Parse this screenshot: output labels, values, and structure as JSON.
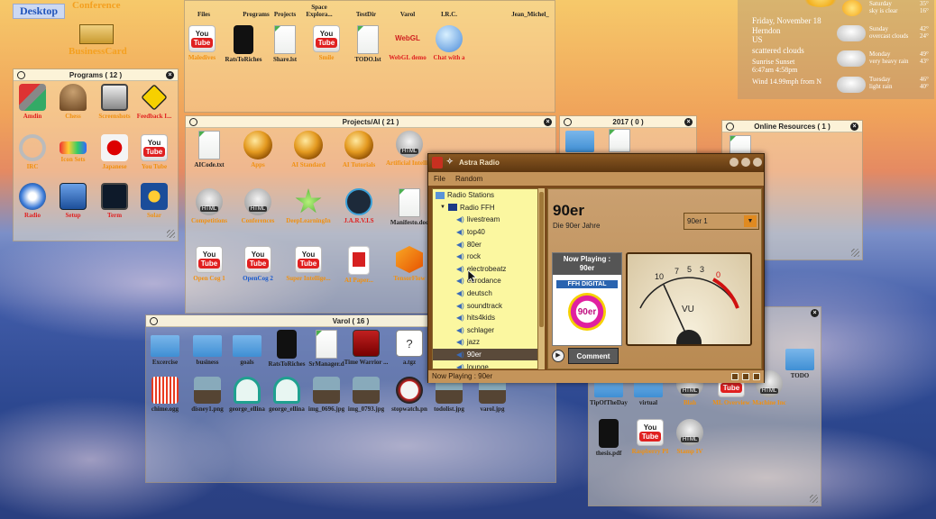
{
  "desktop": {
    "label": "Desktop",
    "conference": "Conference",
    "businesscard": "BusinessCard"
  },
  "top_icons": [
    {
      "label": "Files",
      "icon": "files-icon"
    },
    {
      "label": "Programs",
      "icon": "programs-icon"
    },
    {
      "label": "Projects",
      "icon": "projects-icon"
    },
    {
      "label": "Space Explora...",
      "icon": "space-icon"
    },
    {
      "label": "TestDir",
      "icon": "testdir-icon"
    },
    {
      "label": "Varol",
      "icon": "varol-icon"
    },
    {
      "label": "I.R.C.",
      "icon": "irc-icon"
    },
    {
      "label": "Jean_Michel_",
      "icon": "jean-michel-icon"
    }
  ],
  "top_row2": [
    {
      "label": "Maledives",
      "color": "org",
      "icon": "youtube-icon"
    },
    {
      "label": "RatsToRiches",
      "color": "blk",
      "icon": "book-icon"
    },
    {
      "label": "Share.lst",
      "color": "blk",
      "icon": "document-icon"
    },
    {
      "label": "Smile",
      "color": "org",
      "icon": "youtube-icon"
    },
    {
      "label": "TODO.lst",
      "color": "blk",
      "icon": "document-icon"
    },
    {
      "label": "WebGL demo",
      "color": "red",
      "icon": "webgl-icon"
    },
    {
      "label": "Chat with a",
      "color": "red",
      "icon": "chat-icon"
    }
  ],
  "programs": {
    "title": "Programs ( 12 )",
    "items": [
      {
        "label": "Amdin",
        "color": "red",
        "icon": "admin-tools-icon"
      },
      {
        "label": "Chess",
        "color": "org",
        "icon": "chess-icon"
      },
      {
        "label": "Screenshots",
        "color": "org",
        "icon": "camera-icon"
      },
      {
        "label": "Feedback I...",
        "color": "red",
        "icon": "feedback-icon"
      },
      {
        "label": "IRC",
        "color": "org",
        "icon": "irc-chain-icon"
      },
      {
        "label": "Icon Sets",
        "color": "org",
        "icon": "icon-sets-icon"
      },
      {
        "label": "Japanese",
        "color": "org",
        "icon": "japan-flag-icon"
      },
      {
        "label": "You Tube",
        "color": "org",
        "icon": "youtube-icon"
      },
      {
        "label": "Radio",
        "color": "red",
        "icon": "radio-icon"
      },
      {
        "label": "Setup",
        "color": "red",
        "icon": "setup-icon"
      },
      {
        "label": "Term",
        "color": "red",
        "icon": "terminal-icon"
      },
      {
        "label": "Solar",
        "color": "org",
        "icon": "solar-icon"
      }
    ]
  },
  "projects": {
    "title": "Projects/AI ( 21 )",
    "items": [
      {
        "label": "AICode.txt",
        "color": "blk",
        "icon": "document-icon"
      },
      {
        "label": "Apps",
        "color": "org",
        "icon": "sphere-icon"
      },
      {
        "label": "AI Standard",
        "color": "org",
        "icon": "sphere-icon"
      },
      {
        "label": "AI Tutorials",
        "color": "org",
        "icon": "sphere-icon"
      },
      {
        "label": "Artificial Intelli...",
        "color": "org",
        "icon": "html-icon"
      },
      {
        "label": "Competitions",
        "color": "org",
        "icon": "html-icon"
      },
      {
        "label": "Conferences",
        "color": "org",
        "icon": "html-icon"
      },
      {
        "label": "DeepLearningIn",
        "color": "org",
        "icon": "deep-learning-icon"
      },
      {
        "label": "J.A.R.V.I.S",
        "color": "red",
        "icon": "jarvis-icon"
      },
      {
        "label": "Manifesto.doc",
        "color": "blk",
        "icon": "document-icon"
      },
      {
        "label": "Open Cog 1",
        "color": "org",
        "icon": "youtube-icon"
      },
      {
        "label": "OpenCog 2",
        "color": "blu",
        "icon": "youtube-icon"
      },
      {
        "label": "Super Intellige...",
        "color": "org",
        "icon": "youtube-icon"
      },
      {
        "label": "AI Paper...",
        "color": "org",
        "icon": "pdf-icon"
      },
      {
        "label": "TensorFlow",
        "color": "org",
        "icon": "tensorflow-icon"
      }
    ]
  },
  "year2017": {
    "title": "2017 ( 0 )"
  },
  "online": {
    "title": "Online Resources ( 1 )"
  },
  "varol": {
    "title": "Varol ( 16 )",
    "items": [
      {
        "label": "Excercise",
        "icon": "folder-icon"
      },
      {
        "label": "business",
        "icon": "folder-icon"
      },
      {
        "label": "goals",
        "icon": "folder-icon"
      },
      {
        "label": "RatsToRiches",
        "icon": "book-icon"
      },
      {
        "label": "SrManager.d",
        "icon": "document-icon"
      },
      {
        "label": "Time Warrior ...",
        "icon": "video-icon"
      },
      {
        "label": "a.tgz",
        "icon": "unknown-file-icon"
      },
      {
        "label": "chime.ogg",
        "icon": "audio-icon"
      },
      {
        "label": "disney1.png",
        "icon": "image-icon"
      },
      {
        "label": "george_ellina",
        "icon": "headphones-icon"
      },
      {
        "label": "george_ellina",
        "icon": "headphones-icon"
      },
      {
        "label": "img_0696.jpg",
        "icon": "image-icon"
      },
      {
        "label": "img_0793.jpg",
        "icon": "image-icon"
      },
      {
        "label": "stopwatch.pn",
        "icon": "stopwatch-icon"
      },
      {
        "label": "todolist.jpg",
        "icon": "image-icon"
      },
      {
        "label": "varol.jpg",
        "icon": "image-icon"
      }
    ]
  },
  "rightpanel": {
    "items": [
      {
        "label": "TipOfTheDay",
        "color": "blk"
      },
      {
        "label": "virtual",
        "color": "blk"
      },
      {
        "label": "Blah",
        "color": "org"
      },
      {
        "label": "ML Overview",
        "color": "org"
      },
      {
        "label": "Machine Inc",
        "color": "org"
      },
      {
        "label": "TODO",
        "color": "blk"
      },
      {
        "label": "thesis.pdf",
        "color": "blk"
      },
      {
        "label": "Raspberry PI",
        "color": "org"
      },
      {
        "label": "Stamp IV",
        "color": "org"
      }
    ]
  },
  "weather": {
    "date": "Friday, November 18",
    "city": "Herndon",
    "country": "US",
    "condition": "scattered clouds",
    "sun_labels": "Sunrise   Sunset",
    "sun_times": "6:47am   4:58pm",
    "wind": "Wind 14.99mph from N",
    "days": [
      {
        "day": "Saturday",
        "desc": "sky is clear",
        "hi": "35°",
        "lo": "16°"
      },
      {
        "day": "Sunday",
        "desc": "overcast clouds",
        "hi": "42°",
        "lo": "24°"
      },
      {
        "day": "Monday",
        "desc": "very heavy rain",
        "hi": "49°",
        "lo": "43°"
      },
      {
        "day": "Tuesday",
        "desc": "light rain",
        "hi": "46°",
        "lo": "40°"
      }
    ]
  },
  "radio": {
    "title": "Astra Radio",
    "menu": [
      "File",
      "Random"
    ],
    "tree": [
      {
        "label": "Radio Stations",
        "level": 0
      },
      {
        "label": "Radio FFH",
        "level": 1
      },
      {
        "label": "livestream",
        "level": 2
      },
      {
        "label": "top40",
        "level": 2
      },
      {
        "label": "80er",
        "level": 2
      },
      {
        "label": "rock",
        "level": 2
      },
      {
        "label": "electrobeatz",
        "level": 2
      },
      {
        "label": "eurodance",
        "level": 2
      },
      {
        "label": "deutsch",
        "level": 2
      },
      {
        "label": "soundtrack",
        "level": 2
      },
      {
        "label": "hits4kids",
        "level": 2
      },
      {
        "label": "schlager",
        "level": 2
      },
      {
        "label": "jazz",
        "level": 2
      },
      {
        "label": "90er",
        "level": 2,
        "selected": true
      },
      {
        "label": "lounge",
        "level": 2
      }
    ],
    "station_name": "90er",
    "station_desc": "Die 90er Jahre",
    "select_value": "90er 1",
    "now_playing_head": "Now Playing :",
    "now_playing_name": "90er",
    "logo_brand": "FFH DIGITAL",
    "logo_text": "90er",
    "vu_label": "VU",
    "comment": "Comment",
    "status": "Now Playing : 90er"
  }
}
